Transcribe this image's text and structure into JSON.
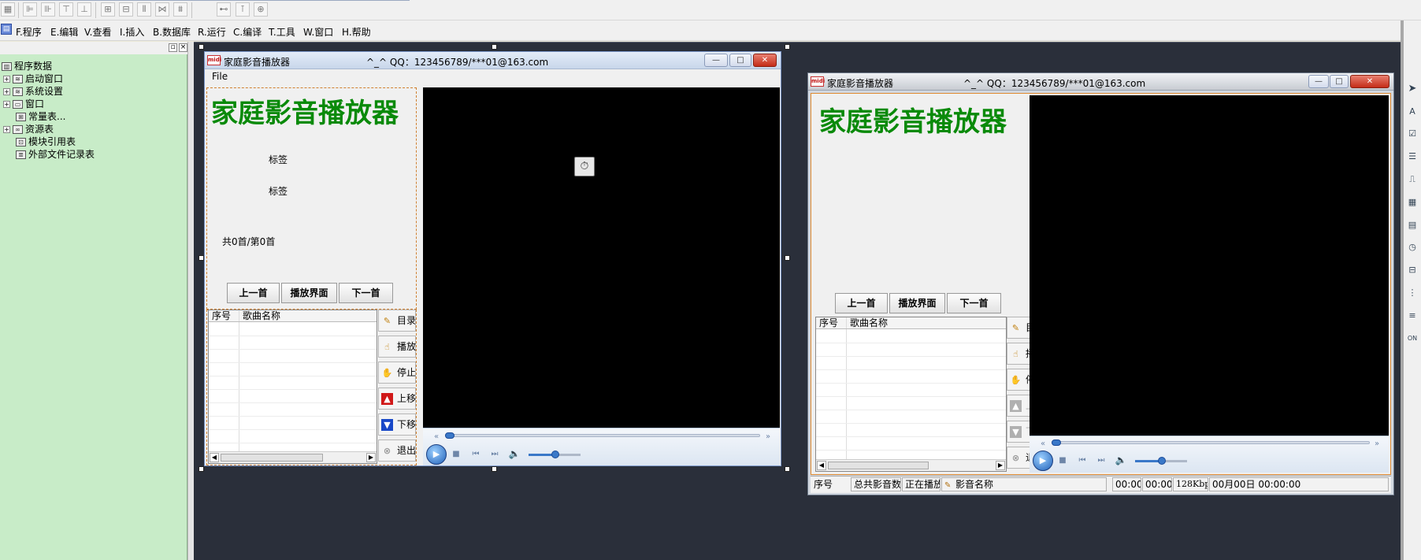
{
  "menubar": {
    "items": [
      "F.程序",
      "E.编辑",
      "V.查看",
      "I.插入",
      "B.数据库",
      "R.运行",
      "C.编译",
      "T.工具",
      "W.窗口",
      "H.帮助"
    ]
  },
  "project_tree": {
    "root": "程序数据",
    "items": [
      "启动窗口",
      "系统设置",
      "窗口",
      "常量表...",
      "资源表",
      "模块引用表",
      "外部文件记录表"
    ]
  },
  "window": {
    "title": "家庭影音播放器",
    "qq_text": "^_^  QQ：123456789/***01@163.com",
    "icon_text": "midi",
    "menu_file": "File",
    "minimize": "—",
    "maximize": "□",
    "close": "✕"
  },
  "player": {
    "app_title": "家庭影音播放器",
    "label_1": "标签",
    "label_2": "标签",
    "count_text": "共0首/第0首",
    "prev_button": "上一首",
    "screen_button": "播放界面",
    "next_button": "下一首",
    "list_col_no": "序号",
    "list_col_name": "歌曲名称",
    "side_buttons": {
      "menu": "目录",
      "play": "播放",
      "stop": "停止",
      "up": "上移",
      "down": "下移",
      "exit": "退出"
    }
  },
  "status_bar": {
    "seq": "序号",
    "total": "总共影音数",
    "playing": "正在播放",
    "media_name": "影音名称",
    "time1": "00:00",
    "time2": "00:00",
    "bitrate": "128Kbps",
    "date_time": "00月00日  00:00:00"
  },
  "colors": {
    "title_green": "#0a8a0a",
    "tree_panel_bg": "#c8ecc8",
    "workspace_bg": "#2a2f3a",
    "selection_orange": "#e08a30"
  },
  "icons": {
    "timer": "stopwatch-icon",
    "menu": "folder-pencil-icon",
    "play": "hand-pointer-icon",
    "stop": "hand-stop-icon",
    "up": "arrow-up-icon",
    "down": "arrow-down-icon",
    "exit": "close-circle-icon"
  }
}
